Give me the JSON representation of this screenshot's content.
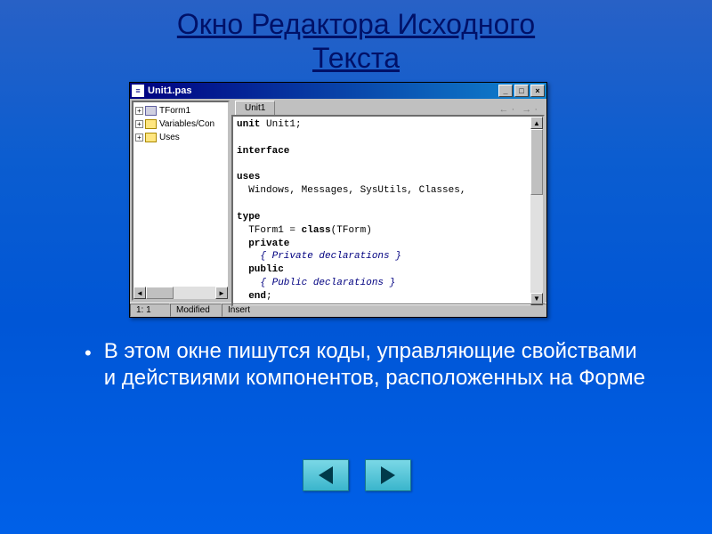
{
  "slide": {
    "title_line1": "Окно Редактора Исходного",
    "title_line2": "Текста",
    "body_text": "В этом окне пишутся коды, управляющие свойствами и действиями компонентов, расположенных на Форме"
  },
  "window": {
    "title": "Unit1.pas",
    "tab_label": "Unit1",
    "nav_back": "←  ·",
    "nav_fwd": "→  ·",
    "tree": {
      "items": [
        {
          "label": "TForm1",
          "icon": "form"
        },
        {
          "label": "Variables/Con",
          "icon": "folder"
        },
        {
          "label": "Uses",
          "icon": "folder"
        }
      ]
    },
    "code": {
      "l1_kw": "unit",
      "l1_rest": " Unit1;",
      "l2_kw": "interface",
      "l3_kw": "uses",
      "l4": "  Windows, Messages, SysUtils, Classes,",
      "l5_kw": "type",
      "l6_a": "  TForm1 = ",
      "l6_kw": "class",
      "l6_b": "(TForm)",
      "l7_kw": "  private",
      "l8_cm": "    { Private declarations }",
      "l9_kw": "  public",
      "l10_cm": "    { Public declarations }",
      "l11_kw": "  end",
      "l11_b": ";"
    },
    "status": {
      "position": "1: 1",
      "modified": "Modified",
      "mode": "Insert"
    }
  }
}
